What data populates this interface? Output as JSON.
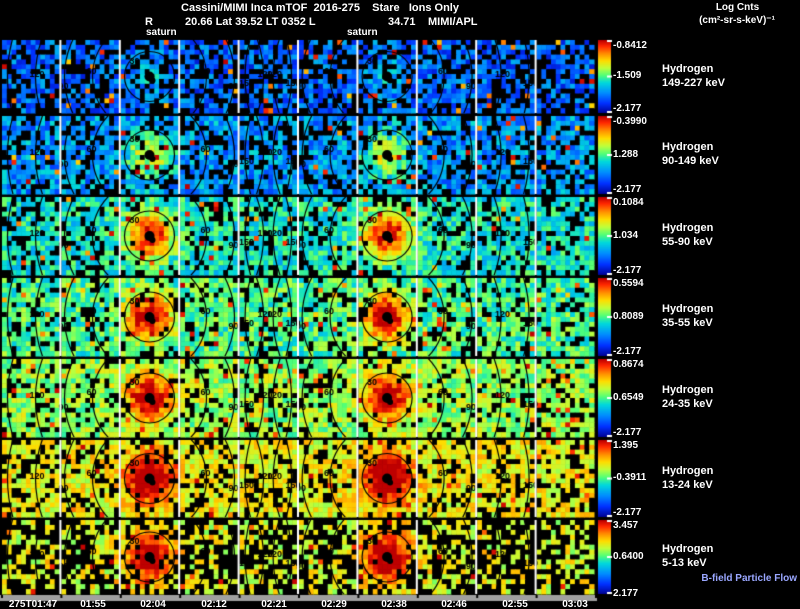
{
  "header": {
    "title": "Cassini/MIMI Inca mTOF  2016-275    Stare   Ions Only",
    "line2": {
      "r_label": "R",
      "position": "20.66 Lat 39.52 LT 0352 L",
      "l_value": "34.71",
      "credit": "MIMI/APL"
    },
    "legend": {
      "title": "Log Cnts",
      "units": "(cm²-sr-s-keV)⁻¹"
    },
    "saturn_labels": [
      "saturn",
      "saturn"
    ]
  },
  "chart_data": {
    "type": "heatmap",
    "title": "Cassini/MIMI Inca mTOF 2016-275 Stare Ions Only",
    "subtitle": "R 20.66 Lat 39.52 LT 0352 L 34.71 MIMI/APL",
    "colorbar_title": "Log Cnts (cm²-sr-s-keV)⁻¹",
    "x": {
      "ticks": [
        "275T01:47",
        "01:55",
        "02:04",
        "02:12",
        "02:21",
        "02:29",
        "02:38",
        "02:46",
        "02:55",
        "03:03"
      ]
    },
    "contour_labels": [
      "30",
      "60",
      "90",
      "120",
      "150"
    ],
    "saturn_marker_times": [
      "02:04",
      "02:38"
    ],
    "legend_note": "B-field Particle Flow",
    "rows": [
      {
        "species": "Hydrogen",
        "energy_range": "149-227 keV",
        "cbar": {
          "max": "-0.8412",
          "mid": "-1.509",
          "min": "-2.177"
        },
        "render": {
          "base": 0.22,
          "spread": 0.13,
          "black": 0.38,
          "speck": 0.05,
          "hot": 0.15,
          "seed": 11
        }
      },
      {
        "species": "Hydrogen",
        "energy_range": "90-149 keV",
        "cbar": {
          "max": "-0.3990",
          "mid": "1.288",
          "min": "-2.177"
        },
        "render": {
          "base": 0.3,
          "spread": 0.14,
          "black": 0.3,
          "speck": 0.04,
          "hot": 0.4,
          "seed": 22
        }
      },
      {
        "species": "Hydrogen",
        "energy_range": "55-90 keV",
        "cbar": {
          "max": "0.1084",
          "mid": "1.034",
          "min": "-2.177"
        },
        "render": {
          "base": 0.44,
          "spread": 0.12,
          "black": 0.22,
          "speck": 0.03,
          "hot": 0.62,
          "seed": 33
        }
      },
      {
        "species": "Hydrogen",
        "energy_range": "35-55 keV",
        "cbar": {
          "max": "0.5594",
          "mid": "0.8089",
          "min": "-2.177"
        },
        "render": {
          "base": 0.5,
          "spread": 0.13,
          "black": 0.2,
          "speck": 0.04,
          "hot": 0.62,
          "seed": 44
        }
      },
      {
        "species": "Hydrogen",
        "energy_range": "24-35 keV",
        "cbar": {
          "max": "0.8674",
          "mid": "0.6549",
          "min": "-2.177"
        },
        "render": {
          "base": 0.58,
          "spread": 0.12,
          "black": 0.2,
          "speck": 0.05,
          "hot": 0.55,
          "seed": 55
        }
      },
      {
        "species": "Hydrogen",
        "energy_range": "13-24 keV",
        "cbar": {
          "max": "1.395",
          "mid": "-0.3911",
          "min": "-2.177"
        },
        "render": {
          "base": 0.68,
          "spread": 0.11,
          "black": 0.26,
          "speck": 0.05,
          "hot": 0.55,
          "seed": 66
        }
      },
      {
        "species": "Hydrogen",
        "energy_range": "5-13 keV",
        "cbar": {
          "max": "3.457",
          "mid": "0.6400",
          "min": "2.177"
        },
        "render": {
          "base": 0.66,
          "spread": 0.11,
          "black": 0.55,
          "speck": 0.06,
          "hot": 0.5,
          "seed": 77
        }
      }
    ]
  },
  "colors": {
    "text": "#ffffff",
    "bfield_label": "#9aa7ff",
    "axis_bar": "#a0a0a0",
    "background": "#000000"
  }
}
